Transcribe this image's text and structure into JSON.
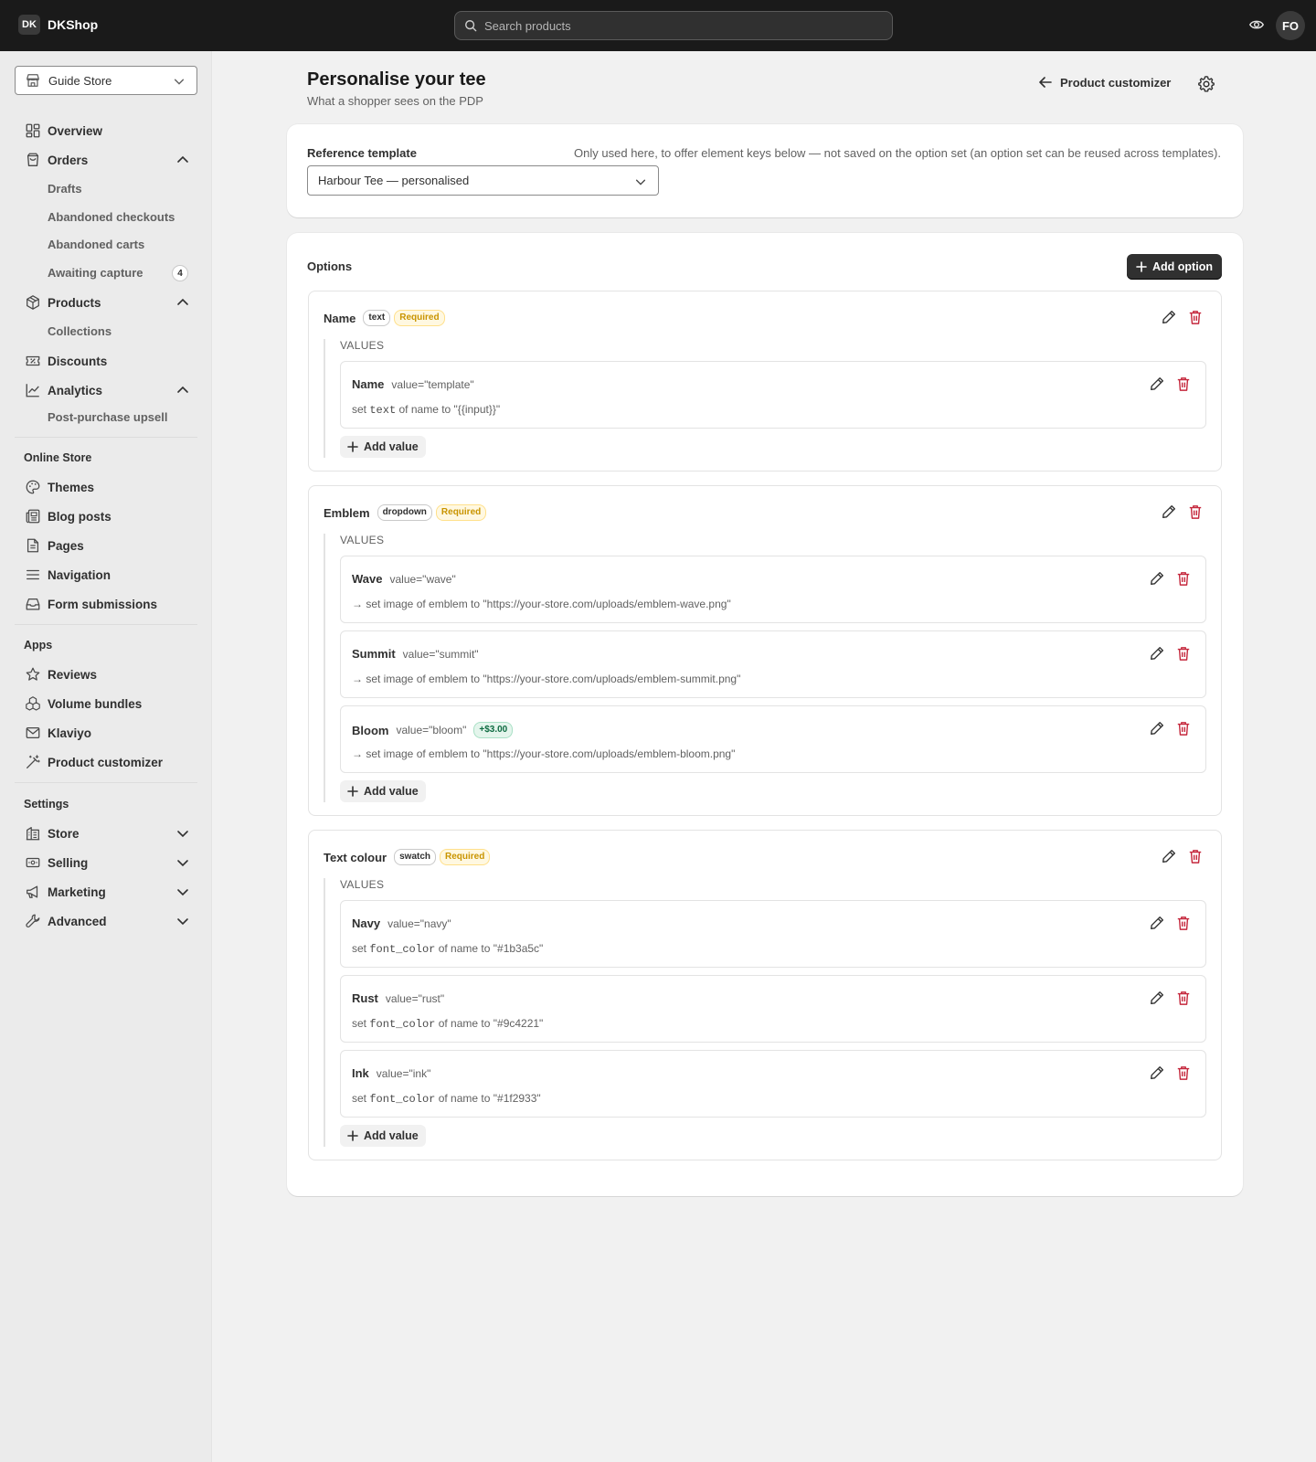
{
  "topbar": {
    "logo": "DK",
    "brand": "DKShop",
    "search_placeholder": "Search products",
    "avatar": "FO"
  },
  "sidebar": {
    "store": "Guide Store",
    "overview": "Overview",
    "orders": "Orders",
    "drafts": "Drafts",
    "abandoned_checkouts": "Abandoned checkouts",
    "abandoned_carts": "Abandoned carts",
    "awaiting_capture": "Awaiting capture",
    "awaiting_capture_count": "4",
    "products": "Products",
    "collections": "Collections",
    "discounts": "Discounts",
    "analytics": "Analytics",
    "post_purchase": "Post-purchase upsell",
    "online_store_title": "Online Store",
    "themes": "Themes",
    "blog_posts": "Blog posts",
    "pages": "Pages",
    "navigation": "Navigation",
    "form_submissions": "Form submissions",
    "apps_title": "Apps",
    "reviews": "Reviews",
    "volume_bundles": "Volume bundles",
    "klaviyo": "Klaviyo",
    "product_customizer": "Product customizer",
    "settings_title": "Settings",
    "store_settings": "Store",
    "selling": "Selling",
    "marketing": "Marketing",
    "advanced": "Advanced"
  },
  "page": {
    "title": "Personalise your tee",
    "subtitle": "What a shopper sees on the PDP",
    "back_label": "Product customizer"
  },
  "reference": {
    "label": "Reference template",
    "help": "Only used here, to offer element keys below — not saved on the option set (an option set can be reused across templates).",
    "selected": "Harbour Tee — personalised"
  },
  "options_section": {
    "title": "Options",
    "add_option": "Add option",
    "values_label": "VALUES",
    "add_value": "Add value"
  },
  "options": [
    {
      "name": "Name",
      "type": "text",
      "required": "Required",
      "values": [
        {
          "name": "Name",
          "value": "value=\"template\"",
          "pre": "set ",
          "code": "text",
          "mid": " of ",
          "target": "name",
          "post": " to \"{{input}}\""
        }
      ]
    },
    {
      "name": "Emblem",
      "type": "dropdown",
      "required": "Required",
      "values": [
        {
          "name": "Wave",
          "value": "value=\"wave\"",
          "action": "→ set image of emblem to \"https://your-store.com/uploads/emblem-wave.png\""
        },
        {
          "name": "Summit",
          "value": "value=\"summit\"",
          "action": "→ set image of emblem to \"https://your-store.com/uploads/emblem-summit.png\""
        },
        {
          "name": "Bloom",
          "value": "value=\"bloom\"",
          "price": "+$3.00",
          "action": "→ set image of emblem to \"https://your-store.com/uploads/emblem-bloom.png\""
        }
      ]
    },
    {
      "name": "Text colour",
      "type": "swatch",
      "required": "Required",
      "values": [
        {
          "name": "Navy",
          "value": "value=\"navy\"",
          "pre": "set ",
          "code": "font_color",
          "mid": " of ",
          "target": "name",
          "post": " to \"#1b3a5c\""
        },
        {
          "name": "Rust",
          "value": "value=\"rust\"",
          "pre": "set ",
          "code": "font_color",
          "mid": " of ",
          "target": "name",
          "post": " to \"#9c4221\""
        },
        {
          "name": "Ink",
          "value": "value=\"ink\"",
          "pre": "set ",
          "code": "font_color",
          "mid": " of ",
          "target": "name",
          "post": " to \"#1f2933\""
        }
      ]
    }
  ],
  "colors": {
    "topbar": "#1a1a1a",
    "delete": "#c5283d",
    "required_text": "#c99400",
    "price_text": "#0d6b41"
  }
}
